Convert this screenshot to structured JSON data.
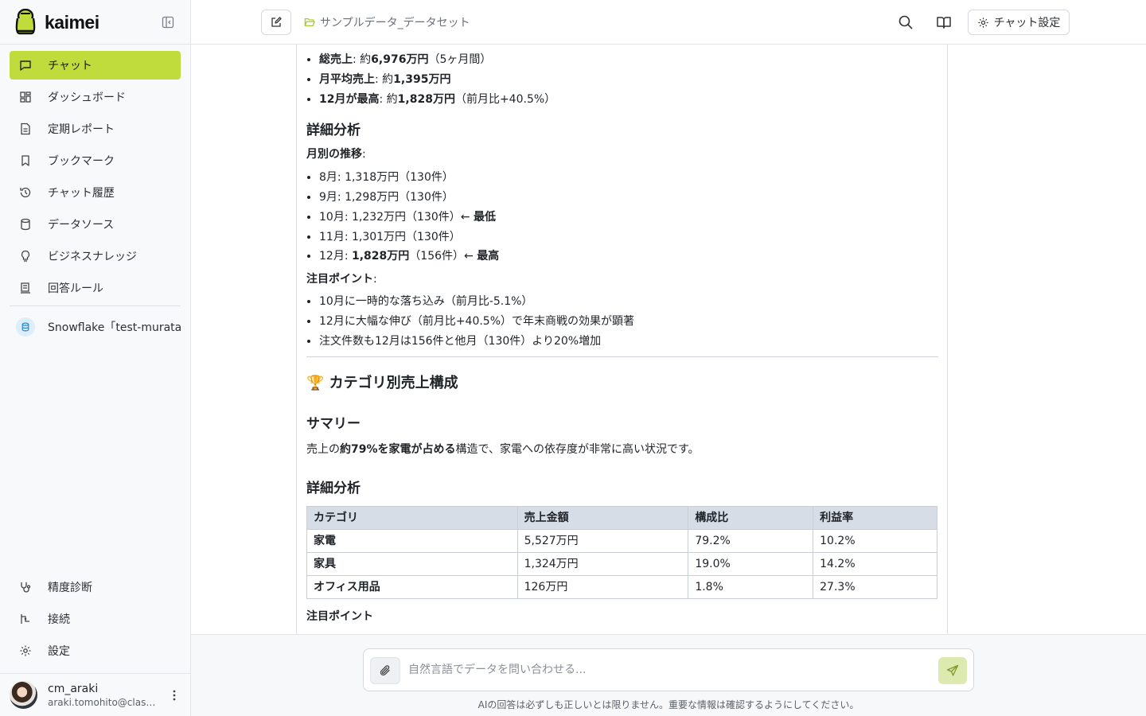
{
  "app": {
    "name": "kaimei",
    "accent": "#bfdc3c"
  },
  "sidebar": {
    "nav": [
      {
        "label": "チャット",
        "icon": "chat-icon",
        "active": true
      },
      {
        "label": "ダッシュボード",
        "icon": "dashboard-icon"
      },
      {
        "label": "定期レポート",
        "icon": "report-icon"
      },
      {
        "label": "ブックマーク",
        "icon": "bookmark-icon"
      },
      {
        "label": "チャット履歴",
        "icon": "history-icon"
      },
      {
        "label": "データソース",
        "icon": "database-icon"
      },
      {
        "label": "ビジネスナレッジ",
        "icon": "lightbulb-icon"
      },
      {
        "label": "回答ルール",
        "icon": "rules-icon"
      }
    ],
    "datasource": {
      "label": "Snowflake「test-murata」"
    },
    "bottom": [
      {
        "label": "精度診断",
        "icon": "stethoscope-icon"
      },
      {
        "label": "接続",
        "icon": "connection-icon"
      },
      {
        "label": "設定",
        "icon": "gear-icon"
      }
    ],
    "user": {
      "name": "cm_araki",
      "email": "araki.tomohito@class..."
    }
  },
  "header": {
    "breadcrumb": "サンプルデータ_データセット",
    "settings_label": "チャット設定"
  },
  "content": {
    "summary_items": [
      {
        "b1": "総売上",
        "t1": ": 約",
        "b2": "6,976万円",
        "t2": "（5ヶ月間）"
      },
      {
        "b1": "月平均売上",
        "t1": ": 約",
        "b2": "1,395万円",
        "t2": ""
      },
      {
        "b1": "12月が最高",
        "t1": ": 約",
        "b2": "1,828万円",
        "t2": "（前月比+40.5%）"
      }
    ],
    "detail_heading": "詳細分析",
    "monthly_label": "月別の推移",
    "monthly": [
      {
        "t": "8月: 1,318万円（130件）",
        "b": ""
      },
      {
        "t": "9月: 1,298万円（130件）",
        "b": ""
      },
      {
        "t": "10月: 1,232万円（130件）← ",
        "b": "最低"
      },
      {
        "t": "11月: 1,301万円（130件）",
        "b": ""
      }
    ],
    "dec_line": {
      "t1": "12月: ",
      "b1": "1,828万円",
      "t2": "（156件）← ",
      "b2": "最高"
    },
    "attention_label": "注目ポイント",
    "attention": [
      "10月に一時的な落ち込み（前月比-5.1%）",
      "12月に大幅な伸び（前月比+40.5%）で年末商戦の効果が顕著",
      "注文件数も12月は156件と他月（130件）より20%増加"
    ],
    "category_heading": "🏆 カテゴリ別売上構成",
    "summary_heading": "サマリー",
    "summary_text": {
      "t1": "売上の",
      "b1": "約79%を家電が占める",
      "t2": "構造で、家電への依存度が非常に高い状況です。"
    },
    "detail_heading2": "詳細分析",
    "table": {
      "headers": [
        "カテゴリ",
        "売上金額",
        "構成比",
        "利益率"
      ],
      "rows": [
        [
          "家電",
          "5,527万円",
          "79.2%",
          "10.2%"
        ],
        [
          "家具",
          "1,324万円",
          "19.0%",
          "14.2%"
        ],
        [
          "オフィス用品",
          "126万円",
          "1.8%",
          "27.3%"
        ]
      ]
    },
    "next_label": "注目ポイント"
  },
  "composer": {
    "placeholder": "自然言語でデータを問い合わせる...",
    "disclaimer": "AIの回答は必ずしも正しいとは限りません。重要な情報は確認するようにしてください。"
  }
}
